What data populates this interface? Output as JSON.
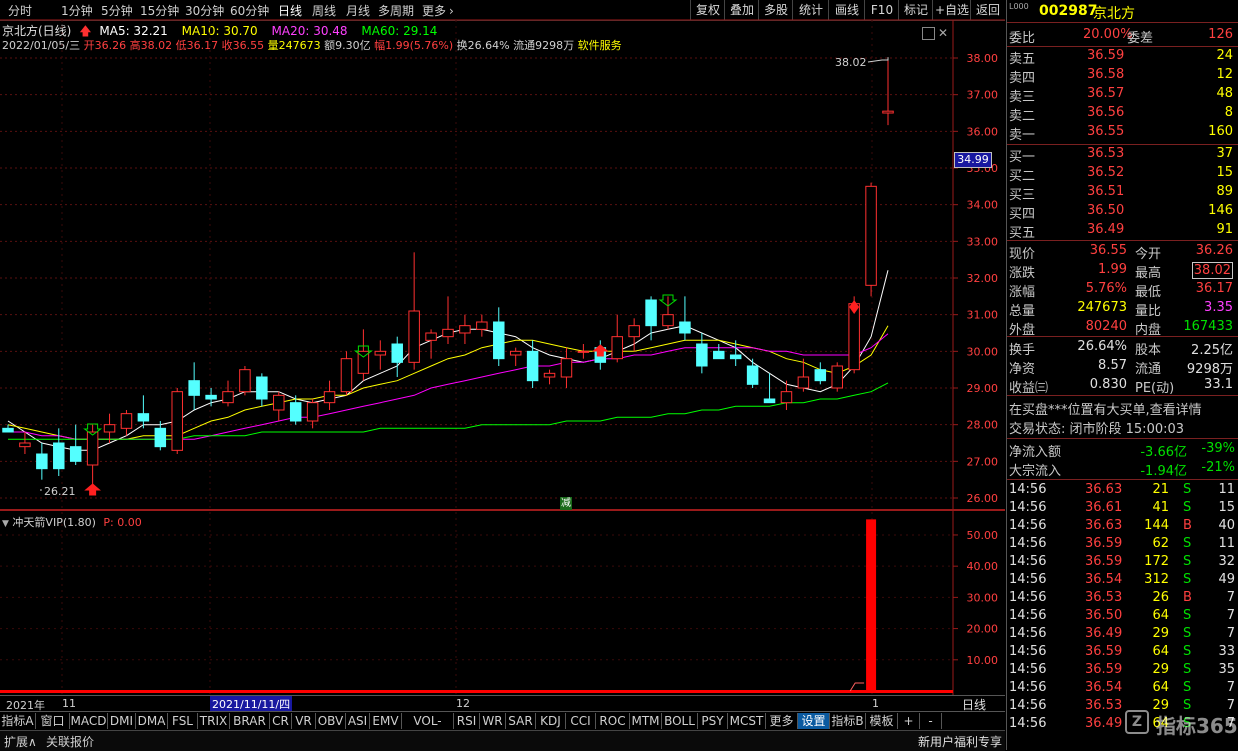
{
  "toolbar": {
    "periods": [
      "分时",
      "1分钟",
      "5分钟",
      "15分钟",
      "30分钟",
      "60分钟",
      "日线",
      "周线",
      "月线",
      "多周期",
      "更多"
    ],
    "active_period": "日线",
    "buttons": [
      "复权",
      "叠加",
      "多股",
      "统计",
      "画线",
      "F10",
      "标记",
      "+自选",
      "返回"
    ]
  },
  "info": {
    "name": "京北方(日线)",
    "ma5": "MA5: 32.21",
    "ma10": "MA10: 30.70",
    "ma20": "MA20: 30.48",
    "ma60": "MA60: 29.14",
    "date": "2022/01/05/三",
    "open": "开36.26",
    "high": "高38.02",
    "low": "低36.17",
    "close": "收36.55",
    "volume": "量247673",
    "amount": "额9.30亿",
    "amp": "幅1.99(5.76%)",
    "turnover": "换26.64%",
    "float": "流通9298万",
    "industry": "软件服务"
  },
  "price_axis": {
    "labels": [
      "38.00",
      "37.00",
      "36.00",
      "35.00",
      "34.00",
      "33.00",
      "32.00",
      "31.00",
      "30.00",
      "29.00",
      "28.00",
      "27.00",
      "26.00"
    ],
    "current": "34.99"
  },
  "annotations": {
    "high": "38.02",
    "low": "26.21",
    "jian": "减"
  },
  "indicator": {
    "name": "冲天箭VIP(1.80)",
    "p": "P: 0.00",
    "axis": [
      "50.00",
      "40.00",
      "30.00",
      "20.00",
      "10.00"
    ]
  },
  "date_axis": {
    "year": "2021年",
    "nov": "11",
    "cursor": "2021/11/11/四",
    "dec": "12",
    "jan": "1",
    "period": "日线"
  },
  "chart_data": {
    "type": "candlestick",
    "ylim": [
      25.8,
      38.3
    ],
    "candles": [
      {
        "o": 27.9,
        "h": 28.0,
        "l": 27.8,
        "c": 27.8
      },
      {
        "o": 27.4,
        "h": 27.8,
        "l": 27.2,
        "c": 27.5
      },
      {
        "o": 27.2,
        "h": 27.5,
        "l": 26.5,
        "c": 26.8
      },
      {
        "o": 27.5,
        "h": 27.9,
        "l": 26.6,
        "c": 26.8
      },
      {
        "o": 27.4,
        "h": 28.0,
        "l": 26.9,
        "c": 27.0
      },
      {
        "o": 26.9,
        "h": 28.0,
        "l": 26.2,
        "c": 27.8
      },
      {
        "o": 27.8,
        "h": 28.3,
        "l": 27.5,
        "c": 28.0
      },
      {
        "o": 27.9,
        "h": 28.4,
        "l": 27.7,
        "c": 28.3
      },
      {
        "o": 28.3,
        "h": 28.8,
        "l": 27.9,
        "c": 28.1
      },
      {
        "o": 27.9,
        "h": 28.1,
        "l": 27.3,
        "c": 27.4
      },
      {
        "o": 27.3,
        "h": 29.0,
        "l": 27.2,
        "c": 28.9
      },
      {
        "o": 29.2,
        "h": 29.7,
        "l": 28.4,
        "c": 28.8
      },
      {
        "o": 28.8,
        "h": 29.0,
        "l": 28.5,
        "c": 28.7
      },
      {
        "o": 28.6,
        "h": 29.2,
        "l": 28.5,
        "c": 28.9
      },
      {
        "o": 28.9,
        "h": 29.6,
        "l": 28.8,
        "c": 29.5
      },
      {
        "o": 29.3,
        "h": 29.4,
        "l": 28.5,
        "c": 28.7
      },
      {
        "o": 28.4,
        "h": 28.9,
        "l": 28.1,
        "c": 28.8
      },
      {
        "o": 28.6,
        "h": 28.8,
        "l": 28.0,
        "c": 28.1
      },
      {
        "o": 28.1,
        "h": 28.7,
        "l": 27.9,
        "c": 28.6
      },
      {
        "o": 28.6,
        "h": 29.2,
        "l": 28.4,
        "c": 28.9
      },
      {
        "o": 28.9,
        "h": 30.0,
        "l": 28.8,
        "c": 29.8
      },
      {
        "o": 29.4,
        "h": 30.6,
        "l": 29.2,
        "c": 30.0
      },
      {
        "o": 29.9,
        "h": 30.3,
        "l": 29.5,
        "c": 30.0
      },
      {
        "o": 30.2,
        "h": 30.4,
        "l": 29.3,
        "c": 29.7
      },
      {
        "o": 29.7,
        "h": 32.7,
        "l": 29.5,
        "c": 31.1
      },
      {
        "o": 30.3,
        "h": 30.6,
        "l": 29.8,
        "c": 30.5
      },
      {
        "o": 30.4,
        "h": 31.5,
        "l": 30.2,
        "c": 30.6
      },
      {
        "o": 30.5,
        "h": 31.0,
        "l": 30.2,
        "c": 30.7
      },
      {
        "o": 30.6,
        "h": 31.0,
        "l": 30.4,
        "c": 30.8
      },
      {
        "o": 30.8,
        "h": 31.2,
        "l": 29.6,
        "c": 29.8
      },
      {
        "o": 29.9,
        "h": 30.1,
        "l": 29.6,
        "c": 30.0
      },
      {
        "o": 30.0,
        "h": 30.3,
        "l": 29.0,
        "c": 29.2
      },
      {
        "o": 29.3,
        "h": 29.5,
        "l": 29.1,
        "c": 29.4
      },
      {
        "o": 29.3,
        "h": 30.1,
        "l": 29.0,
        "c": 29.8
      },
      {
        "o": 30.0,
        "h": 30.2,
        "l": 29.8,
        "c": 30.0
      },
      {
        "o": 30.1,
        "h": 30.3,
        "l": 29.5,
        "c": 29.7
      },
      {
        "o": 29.8,
        "h": 31.0,
        "l": 29.7,
        "c": 30.4
      },
      {
        "o": 30.4,
        "h": 30.9,
        "l": 30.0,
        "c": 30.7
      },
      {
        "o": 31.4,
        "h": 31.5,
        "l": 30.3,
        "c": 30.7
      },
      {
        "o": 30.7,
        "h": 31.5,
        "l": 30.6,
        "c": 31.0
      },
      {
        "o": 30.8,
        "h": 31.5,
        "l": 30.3,
        "c": 30.5
      },
      {
        "o": 30.2,
        "h": 30.5,
        "l": 29.4,
        "c": 29.6
      },
      {
        "o": 30.0,
        "h": 30.2,
        "l": 29.8,
        "c": 29.8
      },
      {
        "o": 29.9,
        "h": 30.3,
        "l": 29.6,
        "c": 29.8
      },
      {
        "o": 29.6,
        "h": 29.8,
        "l": 29.0,
        "c": 29.1
      },
      {
        "o": 28.7,
        "h": 29.4,
        "l": 28.6,
        "c": 28.6
      },
      {
        "o": 28.6,
        "h": 29.2,
        "l": 28.4,
        "c": 28.9
      },
      {
        "o": 29.0,
        "h": 29.8,
        "l": 28.9,
        "c": 29.3
      },
      {
        "o": 29.5,
        "h": 29.7,
        "l": 29.1,
        "c": 29.2
      },
      {
        "o": 29.0,
        "h": 29.7,
        "l": 28.9,
        "c": 29.6
      },
      {
        "o": 29.5,
        "h": 31.5,
        "l": 29.4,
        "c": 31.3
      },
      {
        "o": 31.8,
        "h": 34.6,
        "l": 31.5,
        "c": 34.5
      },
      {
        "o": 36.5,
        "h": 38.02,
        "l": 36.17,
        "c": 36.55
      }
    ],
    "ma": [
      {
        "name": "MA5",
        "color": "#ffffff",
        "values": [
          28.1,
          27.8,
          27.5,
          27.4,
          27.3,
          27.3,
          27.5,
          27.7,
          28.0,
          28.0,
          28.1,
          28.4,
          28.6,
          28.7,
          28.9,
          28.9,
          28.9,
          28.7,
          28.6,
          28.7,
          28.8,
          29.2,
          29.4,
          29.6,
          30.1,
          30.3,
          30.5,
          30.6,
          30.6,
          30.5,
          30.4,
          30.1,
          29.9,
          29.8,
          29.7,
          29.8,
          30.0,
          30.2,
          30.5,
          30.6,
          30.7,
          30.5,
          30.3,
          30.1,
          29.7,
          29.4,
          29.1,
          29.0,
          28.9,
          29.1,
          29.6,
          30.4,
          32.21
        ]
      },
      {
        "name": "MA10",
        "color": "#ffff00",
        "values": [
          28.0,
          27.9,
          27.8,
          27.7,
          27.6,
          27.6,
          27.6,
          27.6,
          27.7,
          27.7,
          27.7,
          27.9,
          28.1,
          28.2,
          28.4,
          28.5,
          28.6,
          28.7,
          28.7,
          28.8,
          28.8,
          29.0,
          29.1,
          29.2,
          29.4,
          29.6,
          29.8,
          29.9,
          30.1,
          30.2,
          30.3,
          30.3,
          30.2,
          30.1,
          30.0,
          30.0,
          30.0,
          30.0,
          30.1,
          30.2,
          30.3,
          30.3,
          30.3,
          30.2,
          30.1,
          30.0,
          29.8,
          29.7,
          29.5,
          29.4,
          29.6,
          29.9,
          30.7
        ]
      },
      {
        "name": "MA20",
        "color": "#ff00ff",
        "values": [
          27.8,
          27.8,
          27.7,
          27.7,
          27.6,
          27.6,
          27.6,
          27.6,
          27.6,
          27.6,
          27.6,
          27.6,
          27.7,
          27.8,
          27.9,
          28.0,
          28.1,
          28.2,
          28.2,
          28.3,
          28.4,
          28.5,
          28.6,
          28.7,
          28.8,
          29.0,
          29.1,
          29.2,
          29.3,
          29.4,
          29.5,
          29.6,
          29.6,
          29.7,
          29.7,
          29.8,
          29.8,
          29.9,
          29.9,
          30.0,
          30.1,
          30.1,
          30.1,
          30.1,
          30.1,
          30.0,
          30.0,
          29.9,
          29.9,
          29.9,
          29.9,
          30.1,
          30.48
        ]
      },
      {
        "name": "MA60",
        "color": "#00ff00",
        "values": [
          27.6,
          27.6,
          27.6,
          27.6,
          27.6,
          27.6,
          27.6,
          27.6,
          27.6,
          27.6,
          27.6,
          27.7,
          27.7,
          27.7,
          27.7,
          27.8,
          27.8,
          27.8,
          27.8,
          27.8,
          27.8,
          27.8,
          27.9,
          27.9,
          27.9,
          27.9,
          27.9,
          27.9,
          28.0,
          28.0,
          28.0,
          28.0,
          28.0,
          28.1,
          28.1,
          28.1,
          28.2,
          28.2,
          28.2,
          28.3,
          28.3,
          28.4,
          28.4,
          28.5,
          28.5,
          28.5,
          28.6,
          28.6,
          28.7,
          28.7,
          28.8,
          28.9,
          29.14
        ]
      }
    ],
    "indicator_ylim": [
      0,
      58
    ],
    "indicator_values": [
      0,
      0,
      0,
      0,
      0,
      0,
      0,
      0,
      0,
      0,
      0,
      0,
      0,
      0,
      0,
      0,
      0,
      0,
      0,
      0,
      0,
      0,
      0,
      0,
      0,
      0,
      0,
      0,
      0,
      0,
      0,
      0,
      0,
      0,
      0,
      0,
      0,
      0,
      0,
      0,
      0,
      0,
      0,
      0,
      0,
      0,
      0,
      0,
      0,
      0,
      0,
      55.0,
      0
    ]
  },
  "tabs": [
    "指标A",
    "窗口",
    "MACD",
    "DMI",
    "DMA",
    "FSL",
    "TRIX",
    "BRAR",
    "CR",
    "VR",
    "OBV",
    "ASI",
    "EMV",
    "VOL-TDX",
    "RSI",
    "WR",
    "SAR",
    "KDJ",
    "CCI",
    "ROC",
    "MTM",
    "BOLL",
    "PSY",
    "MCST",
    "更多",
    "设置",
    "指标B",
    "模板",
    "+",
    "-"
  ],
  "status": {
    "expand": "扩展∧",
    "relate": "关联报价",
    "promo": "新用户福利专享"
  },
  "panel": {
    "code": "002987",
    "name": "京北方",
    "weibi_label": "委比",
    "weibi": "20.00%",
    "weicha_label": "委差",
    "weicha": "126",
    "sell": [
      {
        "label": "卖五",
        "price": "36.59",
        "vol": "24"
      },
      {
        "label": "卖四",
        "price": "36.58",
        "vol": "12"
      },
      {
        "label": "卖三",
        "price": "36.57",
        "vol": "48"
      },
      {
        "label": "卖二",
        "price": "36.56",
        "vol": "8"
      },
      {
        "label": "卖一",
        "price": "36.55",
        "vol": "160"
      }
    ],
    "buy": [
      {
        "label": "买一",
        "price": "36.53",
        "vol": "37"
      },
      {
        "label": "买二",
        "price": "36.52",
        "vol": "15"
      },
      {
        "label": "买三",
        "price": "36.51",
        "vol": "89"
      },
      {
        "label": "买四",
        "price": "36.50",
        "vol": "146"
      },
      {
        "label": "买五",
        "price": "36.49",
        "vol": "91"
      }
    ],
    "quote": [
      {
        "l1": "现价",
        "v1": "36.55",
        "l2": "今开",
        "v2": "36.26"
      },
      {
        "l1": "涨跌",
        "v1": "1.99",
        "l2": "最高",
        "v2": "38.02"
      },
      {
        "l1": "涨幅",
        "v1": "5.76%",
        "l2": "最低",
        "v2": "36.17"
      },
      {
        "l1": "总量",
        "v1": "247673",
        "l2": "量比",
        "v2": "3.35"
      },
      {
        "l1": "外盘",
        "v1": "80240",
        "l2": "内盘",
        "v2": "167433"
      }
    ],
    "stats": [
      {
        "l1": "换手",
        "v1": "26.64%",
        "l2": "股本",
        "v2": "2.25亿"
      },
      {
        "l1": "净资",
        "v1": "8.57",
        "l2": "流通",
        "v2": "9298万"
      },
      {
        "l1": "收益㈢",
        "v1": "0.830",
        "l2": "PE(动)",
        "v2": "33.1"
      }
    ],
    "notice": "在买盘***位置有大买单,查看详情",
    "trade_state": "交易状态: 闭市阶段 15:00:03",
    "flow": [
      {
        "label": "净流入额",
        "value": "-3.66亿",
        "pct": "-39%"
      },
      {
        "label": "大宗流入",
        "value": "-1.94亿",
        "pct": "-21%"
      }
    ],
    "ticks": [
      {
        "t": "14:56",
        "p": "36.63",
        "v": "21",
        "bs": "S",
        "n": "11"
      },
      {
        "t": "14:56",
        "p": "36.61",
        "v": "41",
        "bs": "S",
        "n": "15"
      },
      {
        "t": "14:56",
        "p": "36.63",
        "v": "144",
        "bs": "B",
        "n": "40"
      },
      {
        "t": "14:56",
        "p": "36.59",
        "v": "62",
        "bs": "S",
        "n": "11"
      },
      {
        "t": "14:56",
        "p": "36.59",
        "v": "172",
        "bs": "S",
        "n": "32"
      },
      {
        "t": "14:56",
        "p": "36.54",
        "v": "312",
        "bs": "S",
        "n": "49"
      },
      {
        "t": "14:56",
        "p": "36.53",
        "v": "26",
        "bs": "B",
        "n": "7"
      },
      {
        "t": "14:56",
        "p": "36.50",
        "v": "64",
        "bs": "S",
        "n": "7"
      },
      {
        "t": "14:56",
        "p": "36.49",
        "v": "29",
        "bs": "S",
        "n": "7"
      },
      {
        "t": "14:56",
        "p": "36.59",
        "v": "64",
        "bs": "S",
        "n": "33"
      },
      {
        "t": "14:56",
        "p": "36.59",
        "v": "29",
        "bs": "S",
        "n": "35"
      },
      {
        "t": "14:56",
        "p": "36.54",
        "v": "64",
        "bs": "S",
        "n": "7"
      },
      {
        "t": "14:56",
        "p": "36.53",
        "v": "29",
        "bs": "S",
        "n": "7"
      },
      {
        "t": "14:56",
        "p": "36.49",
        "v": "64",
        "bs": "S",
        "n": "7"
      }
    ],
    "watermark": "指标365"
  },
  "colors": {
    "up": "#ff3030",
    "down": "#54ffff",
    "frame": "#9a1a1a",
    "label": "#c8c8c8",
    "price_up": "#ff4040",
    "vol": "#ffff00",
    "green": "#00e000"
  }
}
